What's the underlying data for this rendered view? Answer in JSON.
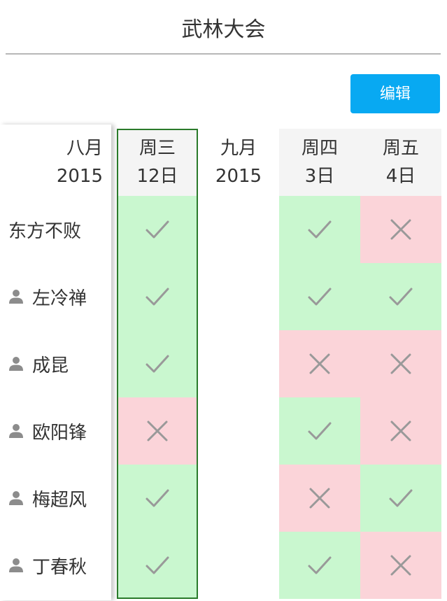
{
  "header": {
    "title": "武林大会"
  },
  "toolbar": {
    "edit_label": "编辑"
  },
  "months": [
    {
      "month": "八月",
      "year": "2015"
    },
    {
      "month": "九月",
      "year": "2015"
    }
  ],
  "dates": [
    {
      "weekday": "周三",
      "day": "12日"
    },
    {
      "weekday": "周四",
      "day": "3日"
    },
    {
      "weekday": "周五",
      "day": "4日"
    }
  ],
  "participants": [
    {
      "name": "东方不败",
      "has_icon": false,
      "votes": [
        "yes",
        "yes",
        "no"
      ]
    },
    {
      "name": "左冷禅",
      "has_icon": true,
      "votes": [
        "yes",
        "yes",
        "yes"
      ]
    },
    {
      "name": "成昆",
      "has_icon": true,
      "votes": [
        "yes",
        "no",
        "no"
      ]
    },
    {
      "name": "欧阳锋",
      "has_icon": true,
      "votes": [
        "no",
        "yes",
        "no"
      ]
    },
    {
      "name": "梅超风",
      "has_icon": true,
      "votes": [
        "yes",
        "no",
        "yes"
      ]
    },
    {
      "name": "丁春秋",
      "has_icon": true,
      "votes": [
        "yes",
        "yes",
        "no"
      ]
    }
  ],
  "colors": {
    "yes_bg": "#c9f7cf",
    "no_bg": "#fbd4d9",
    "mark": "#999999",
    "button": "#08a9f2",
    "selected_border": "#2a7a2a"
  }
}
